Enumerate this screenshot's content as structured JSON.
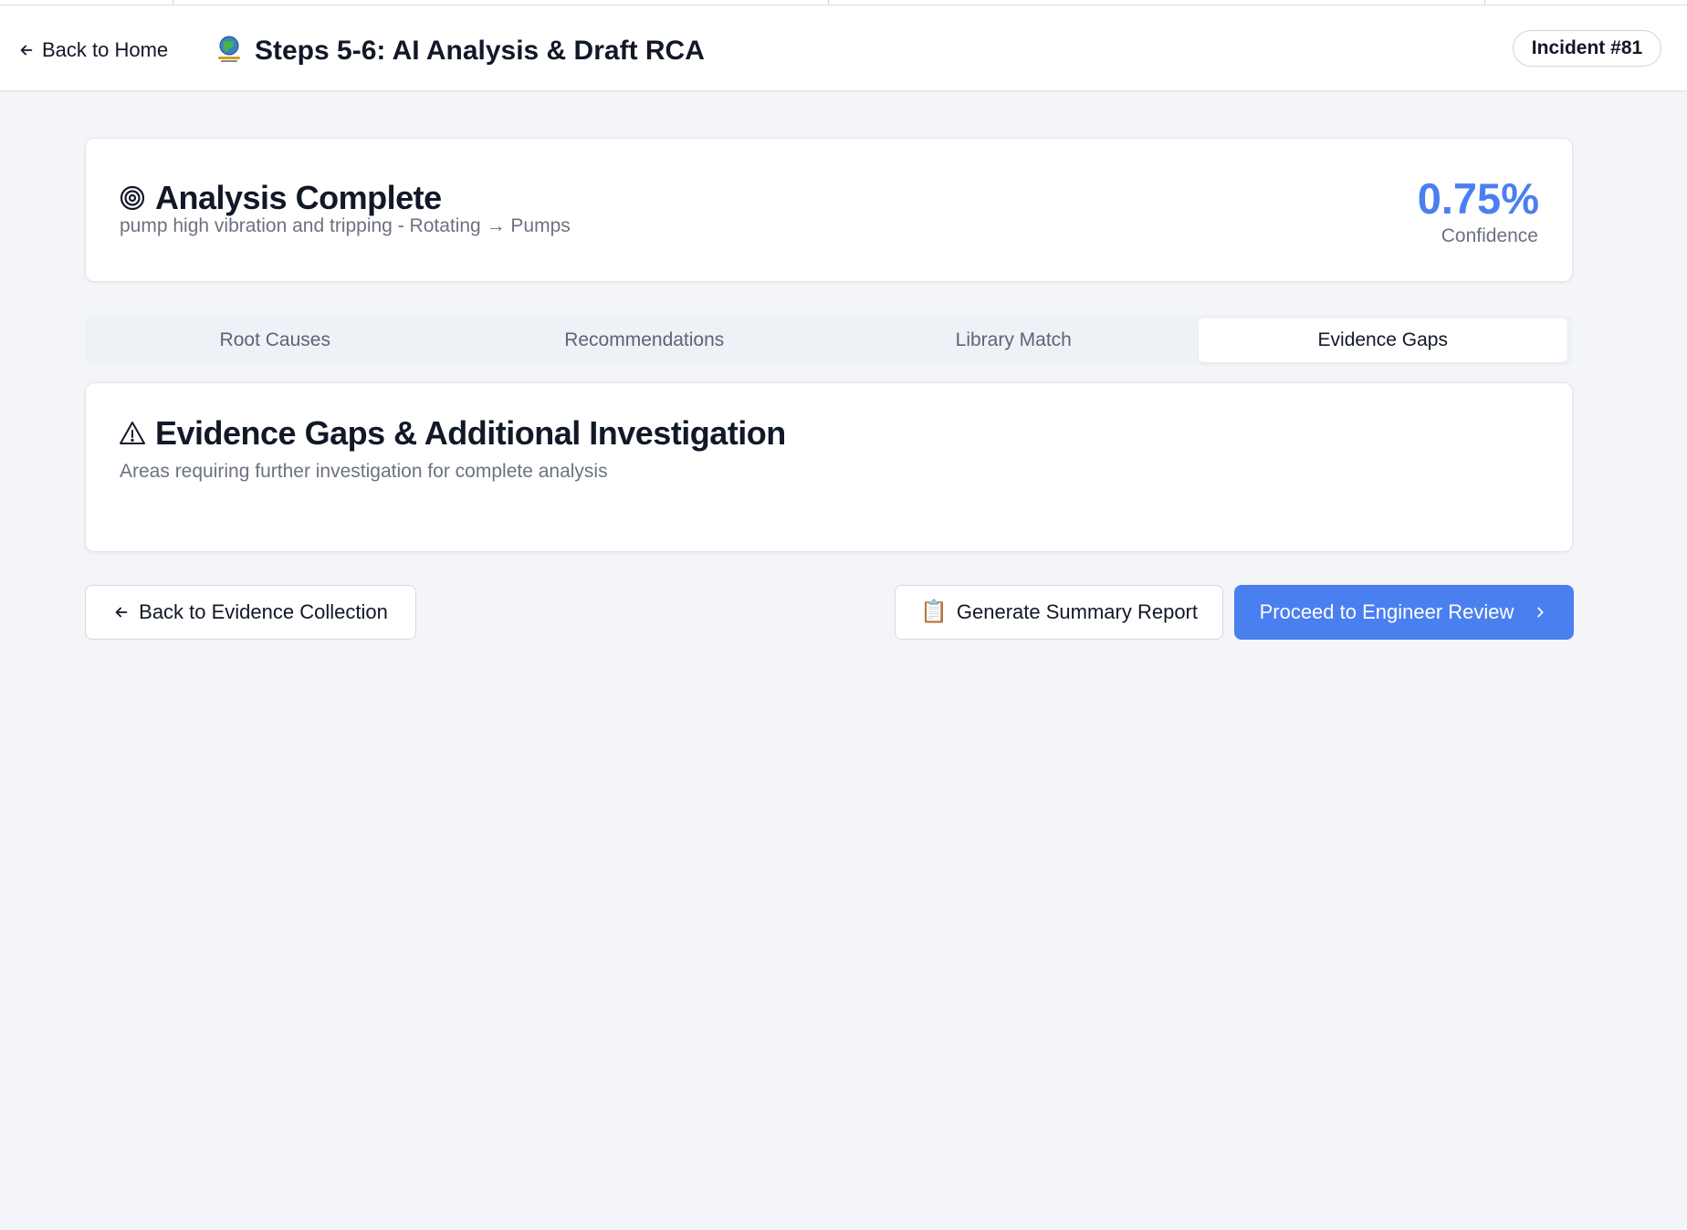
{
  "header": {
    "back_label": "Back to Home",
    "title": "Steps 5-6: AI Analysis & Draft RCA",
    "incident_badge": "Incident #81"
  },
  "summary": {
    "icon": "target-icon",
    "title": "Analysis Complete",
    "subtitle": "pump high vibration and tripping - Rotating → Pumps",
    "confidence_value": "0.75%",
    "confidence_label": "Confidence"
  },
  "tabs": [
    {
      "label": "Root Causes",
      "active": false
    },
    {
      "label": "Recommendations",
      "active": false
    },
    {
      "label": "Library Match",
      "active": false
    },
    {
      "label": "Evidence Gaps",
      "active": true
    }
  ],
  "gaps": {
    "icon": "warning-icon",
    "title": "Evidence Gaps & Additional Investigation",
    "subtitle": "Areas requiring further investigation for complete analysis"
  },
  "actions": {
    "back_label": "Back to Evidence Collection",
    "report_label": "Generate Summary Report",
    "proceed_label": "Proceed to Engineer Review"
  },
  "colors": {
    "accent": "#4a7ff0",
    "background": "#f4f5f9"
  }
}
